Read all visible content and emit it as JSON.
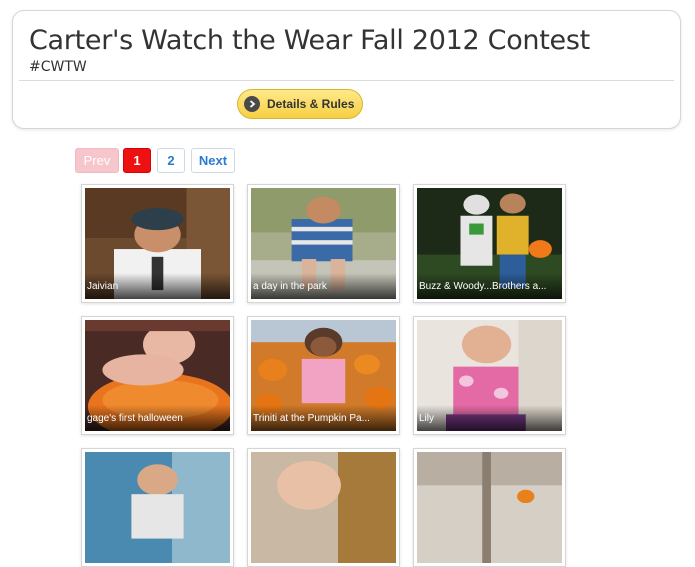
{
  "header": {
    "title": "Carter's Watch the Wear Fall 2012 Contest",
    "hashtag": "#CWTW",
    "details_button": "Details & Rules"
  },
  "pagination": {
    "prev": "Prev",
    "pages": [
      "1",
      "2"
    ],
    "current_page": "1",
    "next": "Next"
  },
  "gallery": {
    "entries": [
      {
        "caption": "Jaivian"
      },
      {
        "caption": "a day in the park"
      },
      {
        "caption": "Buzz & Woody...Brothers a..."
      },
      {
        "caption": "gage's first halloween"
      },
      {
        "caption": "Triniti at the Pumpkin Pa..."
      },
      {
        "caption": "Lily"
      },
      {
        "caption": ""
      },
      {
        "caption": ""
      },
      {
        "caption": ""
      }
    ]
  },
  "colors": {
    "button_yellow": "#f6cf44",
    "current_page_red": "#ee1111",
    "prev_disabled_pink": "#f7c6cc",
    "link_blue": "#2b7bd0"
  },
  "icons": {
    "details_button_icon": "chevron-right-circle-icon"
  }
}
